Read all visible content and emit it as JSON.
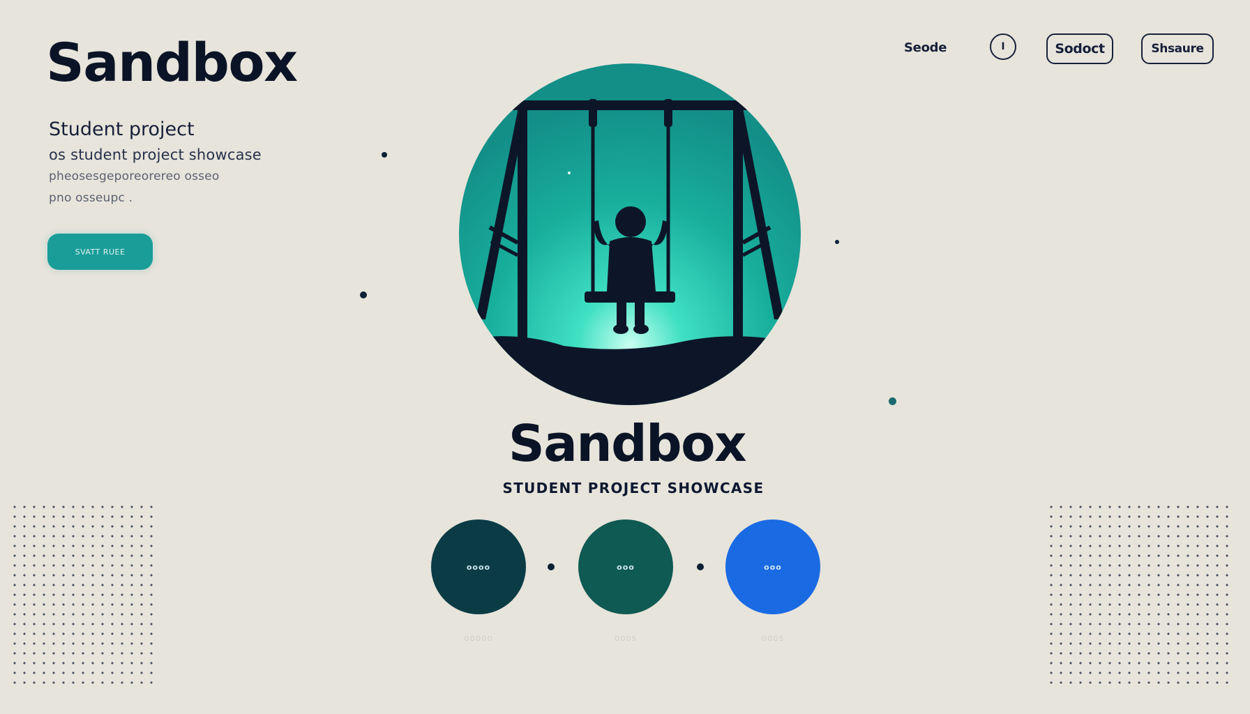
{
  "brand": {
    "title": "Sandbox"
  },
  "intro": {
    "heading": "Student project",
    "line1": "os student project showcase",
    "line2": "pheosesgeporeorereo osseo",
    "line3": "pno osseupc ."
  },
  "cta": {
    "label": "SVATT RUEE"
  },
  "nav": {
    "link": "Seode",
    "circle_label": "I",
    "pill1": "Sodoct",
    "pill2": "Shsaure"
  },
  "hero": {
    "title": "Sandbox",
    "subtitle": "STUDENT PROJECT SHOWCASE",
    "image_icon": "child-on-swing-illustration",
    "colors": {
      "sky": "#1bb39f",
      "glow": "#c9fff0",
      "silhouette": "#0d1628"
    }
  },
  "features": [
    {
      "label": "oooo",
      "caption": "ooooo",
      "color": "#0b3c45"
    },
    {
      "label": "ooo",
      "caption": "ooos",
      "color": "#0f5a52"
    },
    {
      "label": "ooo",
      "caption": "ooos",
      "color": "#1a6ae3"
    }
  ],
  "colors": {
    "background": "#e7e4db",
    "accent": "#1a9d98",
    "text": "#0b1426"
  }
}
